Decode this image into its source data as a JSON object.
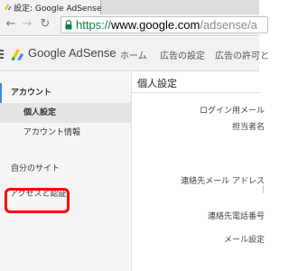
{
  "browser": {
    "tab_title": "設定: Google AdSense",
    "url_scheme": "https://",
    "url_host": "www.google.com",
    "url_path": "/adsense/a"
  },
  "header": {
    "brand": "Google AdSense",
    "nav": [
      "ホーム",
      "広告の設定",
      "広告の許可と"
    ]
  },
  "sidebar": {
    "items": [
      {
        "label": "アカウント"
      },
      {
        "label": "個人設定"
      },
      {
        "label": "アカウント情報"
      },
      {
        "label": "自分のサイト"
      },
      {
        "label": "アクセスと認証"
      }
    ]
  },
  "main": {
    "section_title": "個人設定",
    "fields": [
      {
        "label": "ログイン用メール"
      },
      {
        "label": "担当者名"
      },
      {
        "label": "連絡先メール アドレス"
      },
      {
        "label": "連絡先電話番号"
      },
      {
        "label": "メール設定"
      }
    ]
  },
  "colors": {
    "url_scheme": "#0b8043",
    "active_indicator": "#4285f4",
    "highlight": "#ff0000"
  }
}
